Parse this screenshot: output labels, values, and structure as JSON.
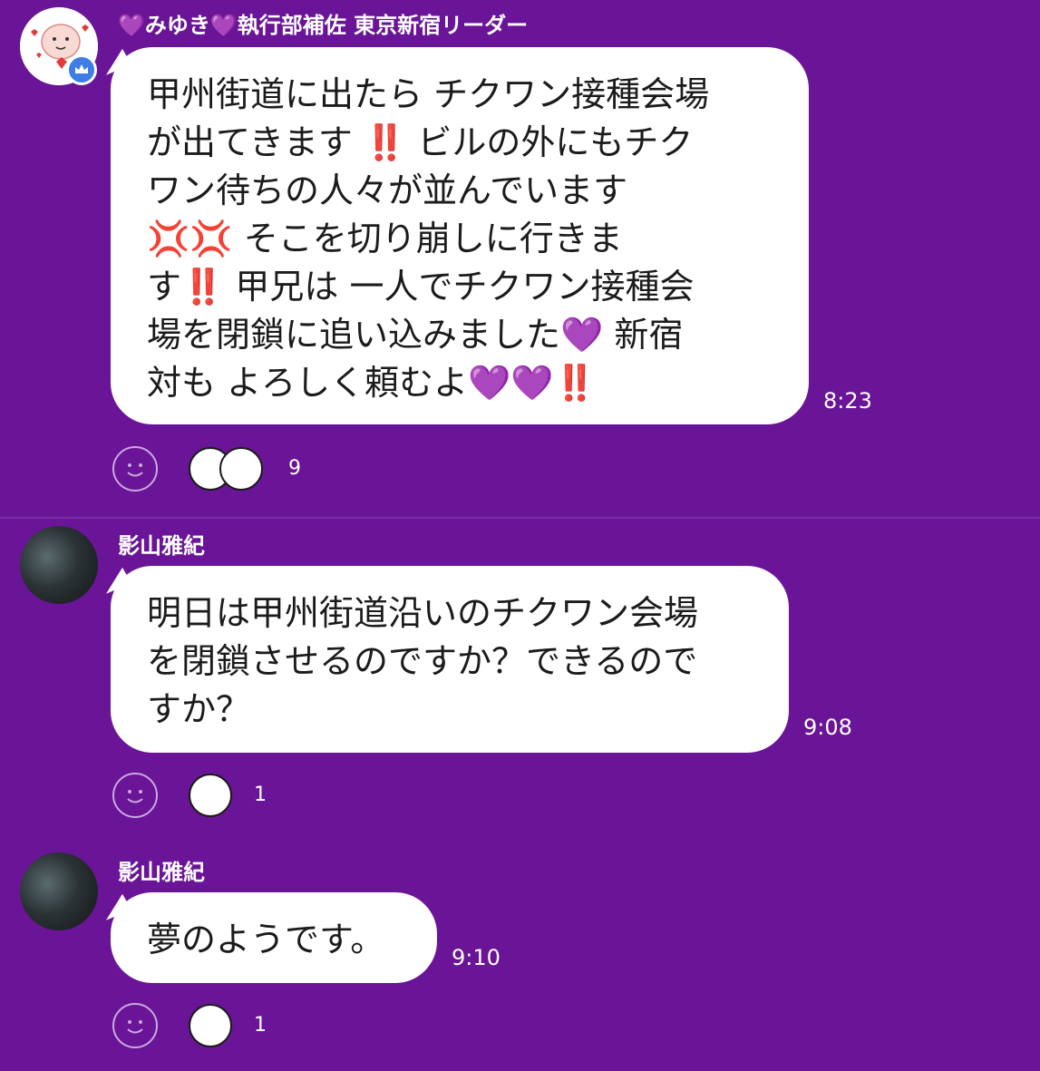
{
  "screens": [
    {
      "message": {
        "sender": {
          "heart_left": "💜",
          "name": "みゆき",
          "heart_right": "💜",
          "title": "執行部補佐 東京新宿リーダー"
        },
        "lines": [
          "甲州街道に出たら チクワン接種会場",
          "が出てきます ‼️ ビルの外にもチク",
          "ワン待ちの人々が並んでいます",
          "💢💢  そこを切り崩しに行きま",
          "す‼️  甲兄は 一人でチクワン接種会",
          "場を閉鎖に追い込みました💜 新宿",
          "対も よろしく頼むよ💜💜‼️"
        ],
        "time": "8:23",
        "reaction_count": "9"
      }
    },
    {
      "messages": [
        {
          "sender": "影山雅紀",
          "lines": [
            "明日は甲州街道沿いのチクワン会場",
            "を閉鎖させるのですか？できるので",
            "すか？"
          ],
          "time": "9:08",
          "reaction_count": "1"
        },
        {
          "sender": "影山雅紀",
          "lines": [
            "夢のようです。"
          ],
          "time": "9:10",
          "reaction_count": "1"
        }
      ]
    }
  ],
  "colors": {
    "background": "#6a1597",
    "bubble": "#ffffff",
    "text": "#1b1b1b",
    "badge": "#3d7de4"
  },
  "icons": {
    "add_reaction": "smiley-outline-icon",
    "badge": "crown-icon",
    "reaction_stickers": [
      "thumbs-up-face-sticker",
      "laughing-face-sticker"
    ]
  }
}
